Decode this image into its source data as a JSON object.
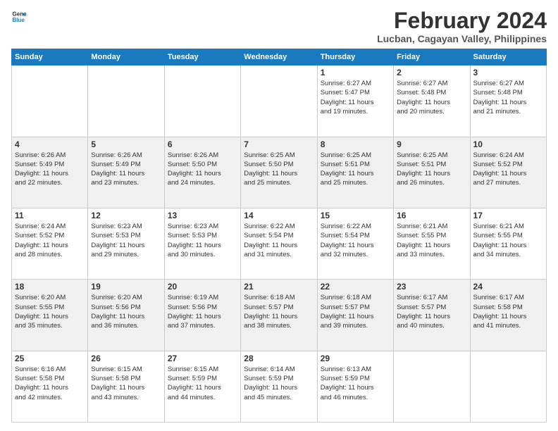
{
  "logo": {
    "line1": "General",
    "line2": "Blue"
  },
  "title": "February 2024",
  "location": "Lucban, Cagayan Valley, Philippines",
  "weekdays": [
    "Sunday",
    "Monday",
    "Tuesday",
    "Wednesday",
    "Thursday",
    "Friday",
    "Saturday"
  ],
  "weeks": [
    [
      {
        "day": "",
        "info": ""
      },
      {
        "day": "",
        "info": ""
      },
      {
        "day": "",
        "info": ""
      },
      {
        "day": "",
        "info": ""
      },
      {
        "day": "1",
        "info": "Sunrise: 6:27 AM\nSunset: 5:47 PM\nDaylight: 11 hours\nand 19 minutes."
      },
      {
        "day": "2",
        "info": "Sunrise: 6:27 AM\nSunset: 5:48 PM\nDaylight: 11 hours\nand 20 minutes."
      },
      {
        "day": "3",
        "info": "Sunrise: 6:27 AM\nSunset: 5:48 PM\nDaylight: 11 hours\nand 21 minutes."
      }
    ],
    [
      {
        "day": "4",
        "info": "Sunrise: 6:26 AM\nSunset: 5:49 PM\nDaylight: 11 hours\nand 22 minutes."
      },
      {
        "day": "5",
        "info": "Sunrise: 6:26 AM\nSunset: 5:49 PM\nDaylight: 11 hours\nand 23 minutes."
      },
      {
        "day": "6",
        "info": "Sunrise: 6:26 AM\nSunset: 5:50 PM\nDaylight: 11 hours\nand 24 minutes."
      },
      {
        "day": "7",
        "info": "Sunrise: 6:25 AM\nSunset: 5:50 PM\nDaylight: 11 hours\nand 25 minutes."
      },
      {
        "day": "8",
        "info": "Sunrise: 6:25 AM\nSunset: 5:51 PM\nDaylight: 11 hours\nand 25 minutes."
      },
      {
        "day": "9",
        "info": "Sunrise: 6:25 AM\nSunset: 5:51 PM\nDaylight: 11 hours\nand 26 minutes."
      },
      {
        "day": "10",
        "info": "Sunrise: 6:24 AM\nSunset: 5:52 PM\nDaylight: 11 hours\nand 27 minutes."
      }
    ],
    [
      {
        "day": "11",
        "info": "Sunrise: 6:24 AM\nSunset: 5:52 PM\nDaylight: 11 hours\nand 28 minutes."
      },
      {
        "day": "12",
        "info": "Sunrise: 6:23 AM\nSunset: 5:53 PM\nDaylight: 11 hours\nand 29 minutes."
      },
      {
        "day": "13",
        "info": "Sunrise: 6:23 AM\nSunset: 5:53 PM\nDaylight: 11 hours\nand 30 minutes."
      },
      {
        "day": "14",
        "info": "Sunrise: 6:22 AM\nSunset: 5:54 PM\nDaylight: 11 hours\nand 31 minutes."
      },
      {
        "day": "15",
        "info": "Sunrise: 6:22 AM\nSunset: 5:54 PM\nDaylight: 11 hours\nand 32 minutes."
      },
      {
        "day": "16",
        "info": "Sunrise: 6:21 AM\nSunset: 5:55 PM\nDaylight: 11 hours\nand 33 minutes."
      },
      {
        "day": "17",
        "info": "Sunrise: 6:21 AM\nSunset: 5:55 PM\nDaylight: 11 hours\nand 34 minutes."
      }
    ],
    [
      {
        "day": "18",
        "info": "Sunrise: 6:20 AM\nSunset: 5:55 PM\nDaylight: 11 hours\nand 35 minutes."
      },
      {
        "day": "19",
        "info": "Sunrise: 6:20 AM\nSunset: 5:56 PM\nDaylight: 11 hours\nand 36 minutes."
      },
      {
        "day": "20",
        "info": "Sunrise: 6:19 AM\nSunset: 5:56 PM\nDaylight: 11 hours\nand 37 minutes."
      },
      {
        "day": "21",
        "info": "Sunrise: 6:18 AM\nSunset: 5:57 PM\nDaylight: 11 hours\nand 38 minutes."
      },
      {
        "day": "22",
        "info": "Sunrise: 6:18 AM\nSunset: 5:57 PM\nDaylight: 11 hours\nand 39 minutes."
      },
      {
        "day": "23",
        "info": "Sunrise: 6:17 AM\nSunset: 5:57 PM\nDaylight: 11 hours\nand 40 minutes."
      },
      {
        "day": "24",
        "info": "Sunrise: 6:17 AM\nSunset: 5:58 PM\nDaylight: 11 hours\nand 41 minutes."
      }
    ],
    [
      {
        "day": "25",
        "info": "Sunrise: 6:16 AM\nSunset: 5:58 PM\nDaylight: 11 hours\nand 42 minutes."
      },
      {
        "day": "26",
        "info": "Sunrise: 6:15 AM\nSunset: 5:58 PM\nDaylight: 11 hours\nand 43 minutes."
      },
      {
        "day": "27",
        "info": "Sunrise: 6:15 AM\nSunset: 5:59 PM\nDaylight: 11 hours\nand 44 minutes."
      },
      {
        "day": "28",
        "info": "Sunrise: 6:14 AM\nSunset: 5:59 PM\nDaylight: 11 hours\nand 45 minutes."
      },
      {
        "day": "29",
        "info": "Sunrise: 6:13 AM\nSunset: 5:59 PM\nDaylight: 11 hours\nand 46 minutes."
      },
      {
        "day": "",
        "info": ""
      },
      {
        "day": "",
        "info": ""
      }
    ]
  ]
}
